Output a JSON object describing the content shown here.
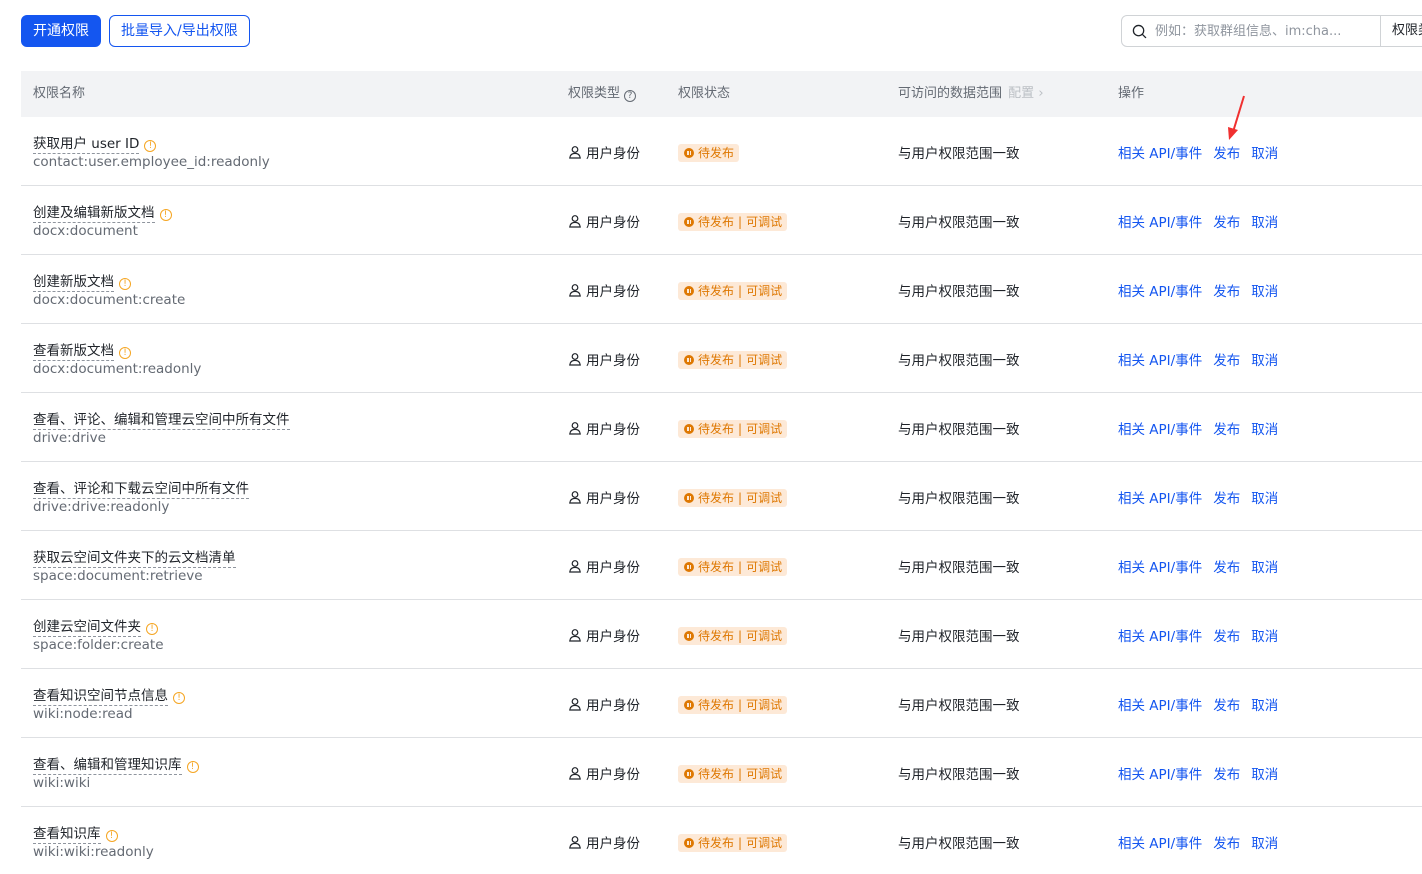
{
  "toolbar": {
    "enable_button": "开通权限",
    "batch_button": "批量导入/导出权限",
    "search_placeholder": "例如：获取群组信息、im:cha...",
    "filter_label": "权限类型"
  },
  "table": {
    "headers": {
      "name": "权限名称",
      "type": "权限类型",
      "status": "权限状态",
      "data_scope": "可访问的数据范围",
      "data_scope_config": "配置",
      "ops": "操作"
    },
    "rows": [
      {
        "name": "获取用户 user ID",
        "scope": "contact:user.employee_id:readonly",
        "warn": true,
        "identity": "用户身份",
        "status_main": "待发布",
        "status_extra": "",
        "data_scope": "与用户权限范围一致",
        "op_api": "相关 API/事件",
        "op_publish": "发布",
        "op_cancel": "取消"
      },
      {
        "name": "创建及编辑新版文档",
        "scope": "docx:document",
        "warn": true,
        "identity": "用户身份",
        "status_main": "待发布",
        "status_extra": "可调试",
        "data_scope": "与用户权限范围一致",
        "op_api": "相关 API/事件",
        "op_publish": "发布",
        "op_cancel": "取消"
      },
      {
        "name": "创建新版文档",
        "scope": "docx:document:create",
        "warn": true,
        "identity": "用户身份",
        "status_main": "待发布",
        "status_extra": "可调试",
        "data_scope": "与用户权限范围一致",
        "op_api": "相关 API/事件",
        "op_publish": "发布",
        "op_cancel": "取消"
      },
      {
        "name": "查看新版文档",
        "scope": "docx:document:readonly",
        "warn": true,
        "identity": "用户身份",
        "status_main": "待发布",
        "status_extra": "可调试",
        "data_scope": "与用户权限范围一致",
        "op_api": "相关 API/事件",
        "op_publish": "发布",
        "op_cancel": "取消"
      },
      {
        "name": "查看、评论、编辑和管理云空间中所有文件",
        "scope": "drive:drive",
        "warn": false,
        "identity": "用户身份",
        "status_main": "待发布",
        "status_extra": "可调试",
        "data_scope": "与用户权限范围一致",
        "op_api": "相关 API/事件",
        "op_publish": "发布",
        "op_cancel": "取消"
      },
      {
        "name": "查看、评论和下载云空间中所有文件",
        "scope": "drive:drive:readonly",
        "warn": false,
        "identity": "用户身份",
        "status_main": "待发布",
        "status_extra": "可调试",
        "data_scope": "与用户权限范围一致",
        "op_api": "相关 API/事件",
        "op_publish": "发布",
        "op_cancel": "取消"
      },
      {
        "name": "获取云空间文件夹下的云文档清单",
        "scope": "space:document:retrieve",
        "warn": false,
        "identity": "用户身份",
        "status_main": "待发布",
        "status_extra": "可调试",
        "data_scope": "与用户权限范围一致",
        "op_api": "相关 API/事件",
        "op_publish": "发布",
        "op_cancel": "取消"
      },
      {
        "name": "创建云空间文件夹",
        "scope": "space:folder:create",
        "warn": true,
        "identity": "用户身份",
        "status_main": "待发布",
        "status_extra": "可调试",
        "data_scope": "与用户权限范围一致",
        "op_api": "相关 API/事件",
        "op_publish": "发布",
        "op_cancel": "取消"
      },
      {
        "name": "查看知识空间节点信息",
        "scope": "wiki:node:read",
        "warn": true,
        "identity": "用户身份",
        "status_main": "待发布",
        "status_extra": "可调试",
        "data_scope": "与用户权限范围一致",
        "op_api": "相关 API/事件",
        "op_publish": "发布",
        "op_cancel": "取消"
      },
      {
        "name": "查看、编辑和管理知识库",
        "scope": "wiki:wiki",
        "warn": true,
        "identity": "用户身份",
        "status_main": "待发布",
        "status_extra": "可调试",
        "data_scope": "与用户权限范围一致",
        "op_api": "相关 API/事件",
        "op_publish": "发布",
        "op_cancel": "取消"
      },
      {
        "name": "查看知识库",
        "scope": "wiki:wiki:readonly",
        "warn": true,
        "identity": "用户身份",
        "status_main": "待发布",
        "status_extra": "可调试",
        "data_scope": "与用户权限范围一致",
        "op_api": "相关 API/事件",
        "op_publish": "发布",
        "op_cancel": "取消"
      }
    ]
  },
  "colors": {
    "primary": "#1456f0",
    "status_bg": "#fde9d7",
    "status_fg": "#de7802",
    "warn": "#f5a623",
    "annotation_arrow": "#f03030"
  }
}
